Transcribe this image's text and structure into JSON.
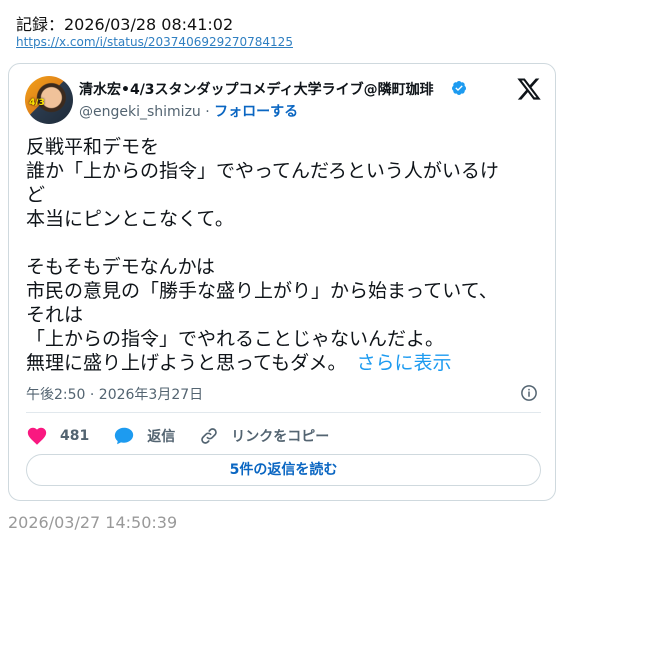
{
  "record": {
    "header": "記録：2026/03/28 08:41:02",
    "link": "https://x.com/i/status/2037406929270784125"
  },
  "tweet": {
    "author_name": "清水宏•4/3スタンダップコメディ大学ライブ@隣町珈琲",
    "handle": "@engeki_shimizu",
    "separator": "·",
    "follow_label": "フォローする",
    "avatar_badge": "4/3",
    "lines": [
      "反戦平和デモを",
      "誰か「上からの指令」でやってんだろという人がいるけ",
      "ど",
      "本当にピンとこなくて。",
      "",
      "そもそもデモなんかは",
      "市民の意見の「勝手な盛り上がり」から始まっていて、",
      "それは",
      "「上からの指令」でやれることじゃないんだよ。",
      "無理に盛り上げようと思ってもダメ。"
    ],
    "show_more": "さらに表示",
    "timestamp": "午後2:50 · 2026年3月27日",
    "like_count": "481",
    "reply_label": "返信",
    "copy_link_label": "リンクをコピー",
    "read_replies_label": "5件の返信を読む"
  },
  "footer": {
    "time": "2026/03/27 14:50:39"
  },
  "colors": {
    "accent": "#1d9bf0",
    "follow": "#0a66c2",
    "like": "#f91880",
    "text": "#0f1419",
    "muted": "#536471"
  },
  "icons": [
    "x-logo-icon",
    "verified-badge-icon",
    "info-icon",
    "heart-icon",
    "reply-bubble-icon",
    "link-icon"
  ]
}
